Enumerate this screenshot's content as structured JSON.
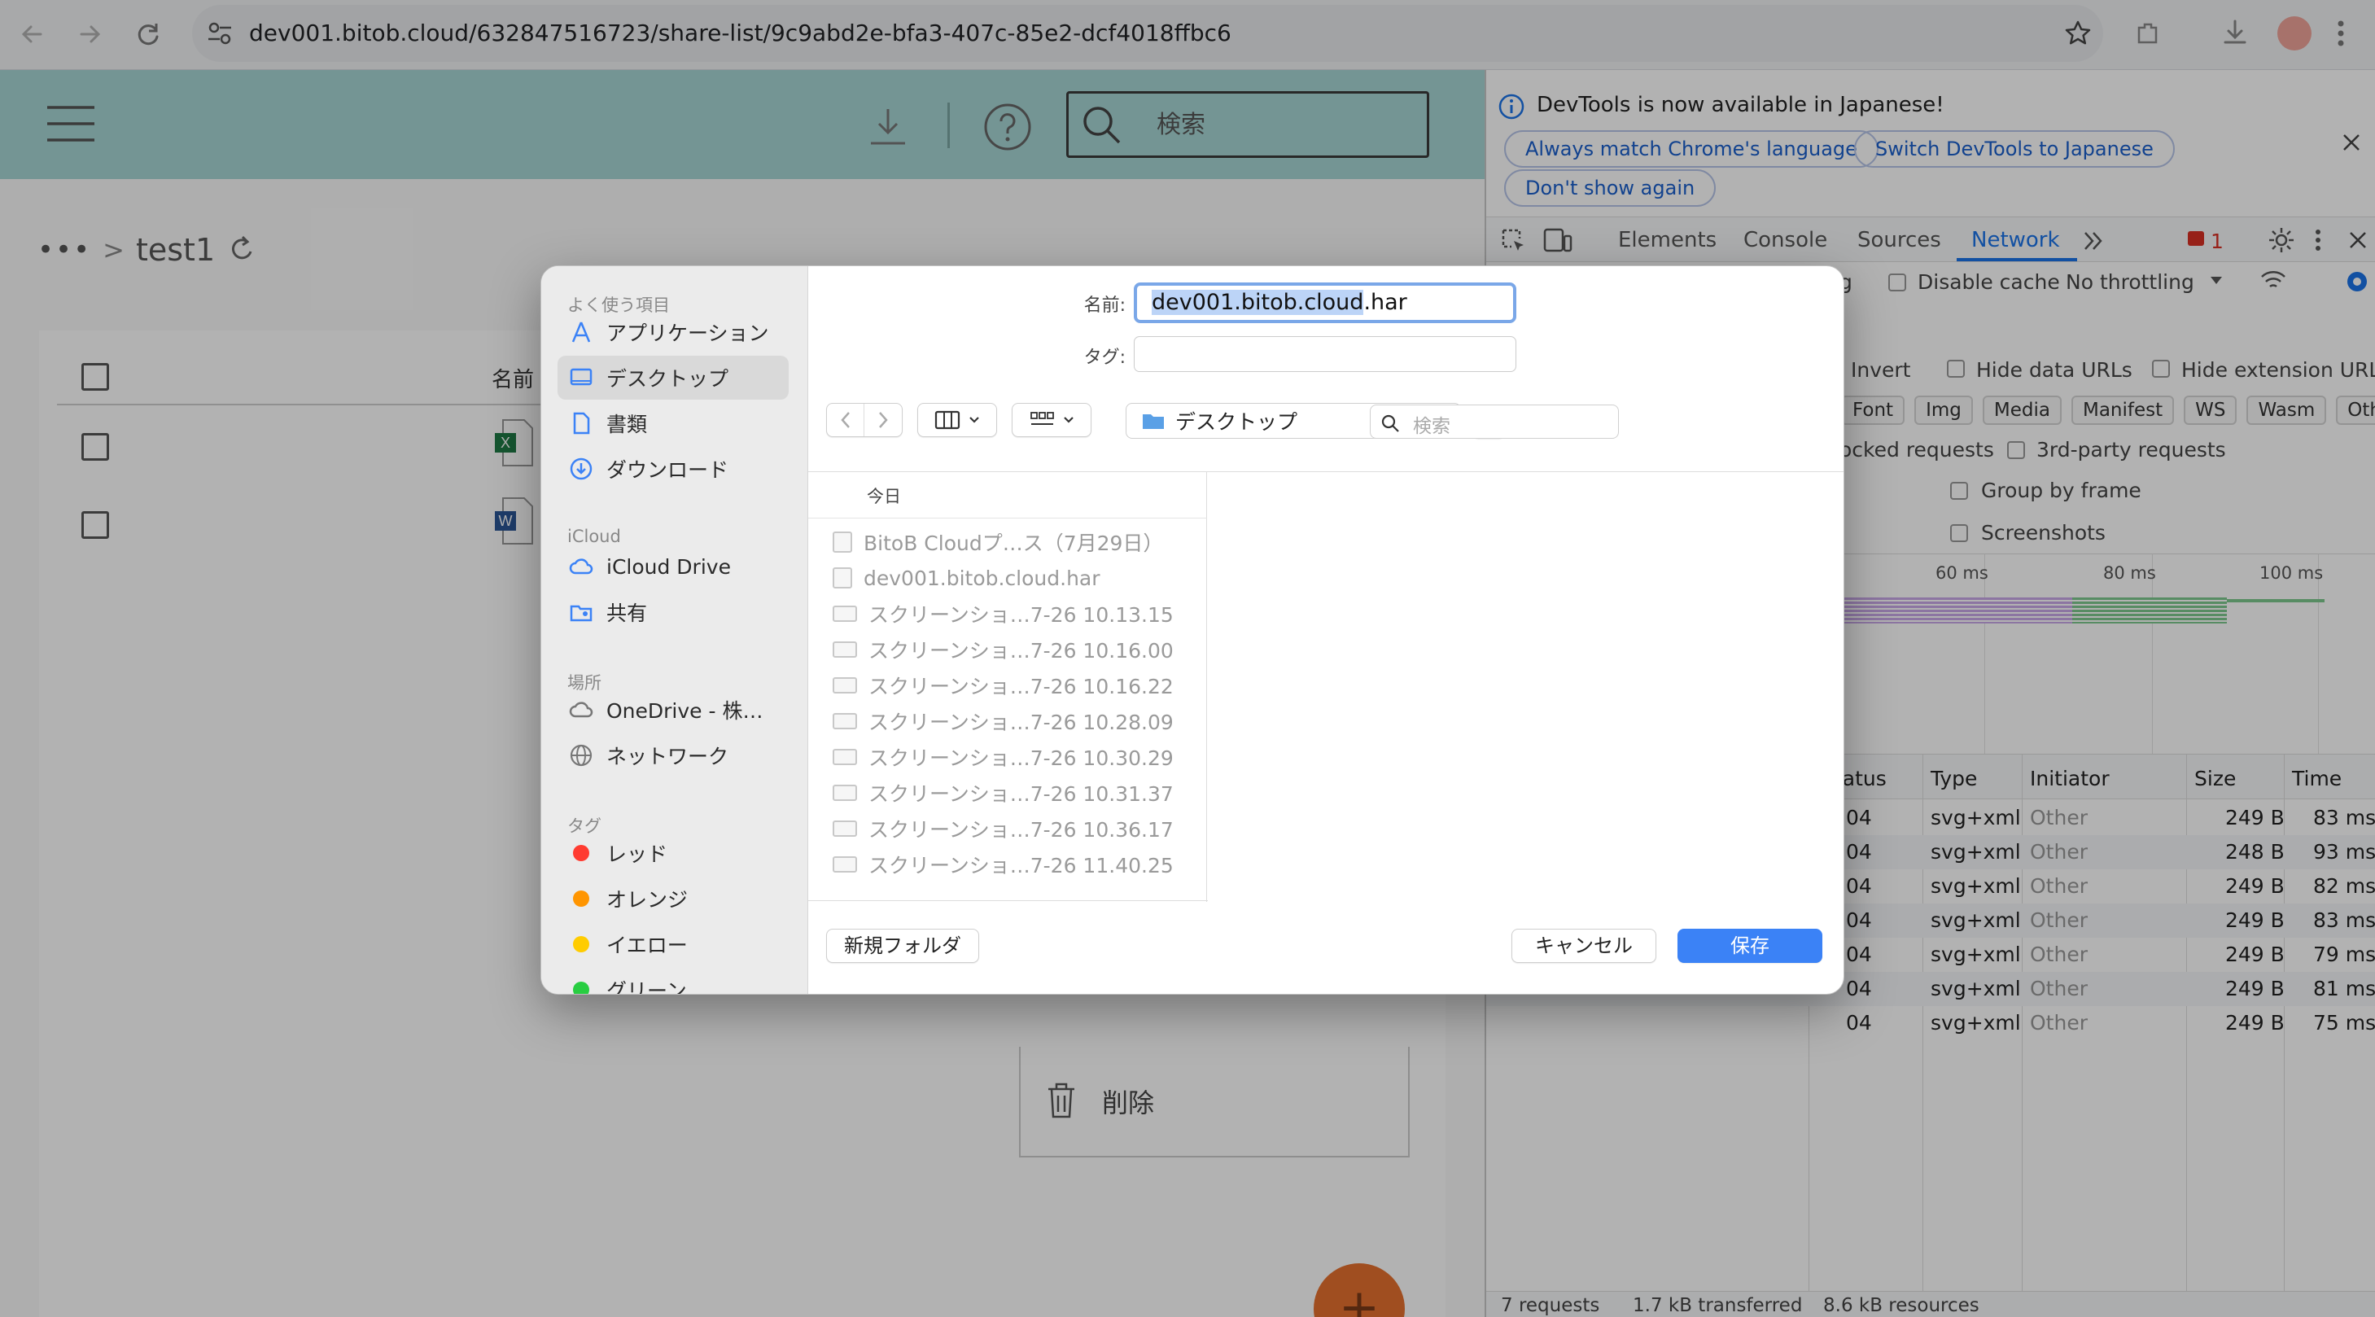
{
  "browser": {
    "url": "dev001.bitob.cloud/632847516723/share-list/9c9abd2e-bfa3-407c-85e2-dcf4018ffbc6"
  },
  "app": {
    "search_placeholder": "検索",
    "breadcrumb": {
      "ellipsis": "•••",
      "separator": ">",
      "current": "test1"
    },
    "column_name": "名前",
    "context_menu": {
      "delete": "削除"
    },
    "fab_label": "+"
  },
  "devtools": {
    "banner": {
      "message": "DevTools is now available in Japanese!",
      "buttons": [
        "Always match Chrome's language",
        "Switch DevTools to Japanese",
        "Don't show again"
      ]
    },
    "tabs": [
      "Elements",
      "Console",
      "Sources",
      "Network"
    ],
    "active_tab": "Network",
    "issues_count": "1",
    "toolbar": {
      "partial": "g",
      "disable_cache": "Disable cache",
      "throttling": "No throttling"
    },
    "filters": {
      "invert": "Invert",
      "hide_data_urls": "Hide data URLs",
      "hide_extension_urls": "Hide extension URLs",
      "types": [
        "Font",
        "Img",
        "Media",
        "Manifest",
        "WS",
        "Wasm",
        "Other"
      ],
      "blocked_requests": "ocked requests",
      "third_party": "3rd-party requests",
      "group_by_frame": "Group by frame",
      "screenshots": "Screenshots"
    },
    "timeline_ticks": [
      "60 ms",
      "80 ms",
      "100 ms"
    ],
    "table": {
      "headers": [
        "tatus",
        "Type",
        "Initiator",
        "Size",
        "Time"
      ],
      "rows": [
        {
          "status": "04",
          "type": "svg+xml",
          "initiator": "Other",
          "size": "249 B",
          "time": "83 ms"
        },
        {
          "status": "04",
          "type": "svg+xml",
          "initiator": "Other",
          "size": "248 B",
          "time": "93 ms"
        },
        {
          "status": "04",
          "type": "svg+xml",
          "initiator": "Other",
          "size": "249 B",
          "time": "82 ms"
        },
        {
          "status": "04",
          "type": "svg+xml",
          "initiator": "Other",
          "size": "249 B",
          "time": "83 ms"
        },
        {
          "status": "04",
          "type": "svg+xml",
          "initiator": "Other",
          "size": "249 B",
          "time": "79 ms"
        },
        {
          "status": "04",
          "type": "svg+xml",
          "initiator": "Other",
          "size": "249 B",
          "time": "81 ms"
        },
        {
          "status": "04",
          "type": "svg+xml",
          "initiator": "Other",
          "size": "249 B",
          "time": "75 ms"
        }
      ]
    },
    "status_bar": [
      "7 requests",
      "1.7 kB transferred",
      "8.6 kB resources"
    ]
  },
  "dialog": {
    "sidebar": {
      "favorites_header": "よく使う項目",
      "favorites": [
        {
          "label": "アプリケーション",
          "icon": "applications-icon"
        },
        {
          "label": "デスクトップ",
          "icon": "desktop-icon",
          "selected": true
        },
        {
          "label": "書類",
          "icon": "document-icon"
        },
        {
          "label": "ダウンロード",
          "icon": "download-icon"
        }
      ],
      "icloud_header": "iCloud",
      "icloud": [
        {
          "label": "iCloud Drive",
          "icon": "cloud-icon"
        },
        {
          "label": "共有",
          "icon": "shared-folder-icon"
        }
      ],
      "locations_header": "場所",
      "locations": [
        {
          "label": "OneDrive - 株…",
          "icon": "cloud-icon"
        },
        {
          "label": "ネットワーク",
          "icon": "globe-icon"
        }
      ],
      "tags_header": "タグ",
      "tags": [
        {
          "label": "レッド",
          "color": "#ff3b30"
        },
        {
          "label": "オレンジ",
          "color": "#ff9500"
        },
        {
          "label": "イエロー",
          "color": "#ffcc00"
        },
        {
          "label": "グリーン",
          "color": "#28cd41"
        }
      ]
    },
    "name_label": "名前:",
    "filename_selected": "dev001.bitob.cloud",
    "filename_ext": ".har",
    "tag_label": "タグ:",
    "location": "デスクトップ",
    "search_placeholder": "検索",
    "section_header": "今日",
    "files": [
      {
        "name": "BitoB Cloudプ…ス（7月29日）",
        "kind": "doc"
      },
      {
        "name": "dev001.bitob.cloud.har",
        "kind": "doc"
      },
      {
        "name": "スクリーンショ…7-26 10.13.15",
        "kind": "img"
      },
      {
        "name": "スクリーンショ…7-26 10.16.00",
        "kind": "img"
      },
      {
        "name": "スクリーンショ…7-26 10.16.22",
        "kind": "img"
      },
      {
        "name": "スクリーンショ…7-26 10.28.09",
        "kind": "img"
      },
      {
        "name": "スクリーンショ…7-26 10.30.29",
        "kind": "img"
      },
      {
        "name": "スクリーンショ…7-26 10.31.37",
        "kind": "img"
      },
      {
        "name": "スクリーンショ…7-26 10.36.17",
        "kind": "img"
      },
      {
        "name": "スクリーンショ…7-26 11.40.25",
        "kind": "img"
      }
    ],
    "new_folder": "新規フォルダ",
    "cancel": "キャンセル",
    "save": "保存"
  },
  "colors": {
    "accent": "#1a73e8",
    "app_header": "#a7d6d4",
    "save_button": "#3b82f6",
    "fab": "#e6702e"
  }
}
